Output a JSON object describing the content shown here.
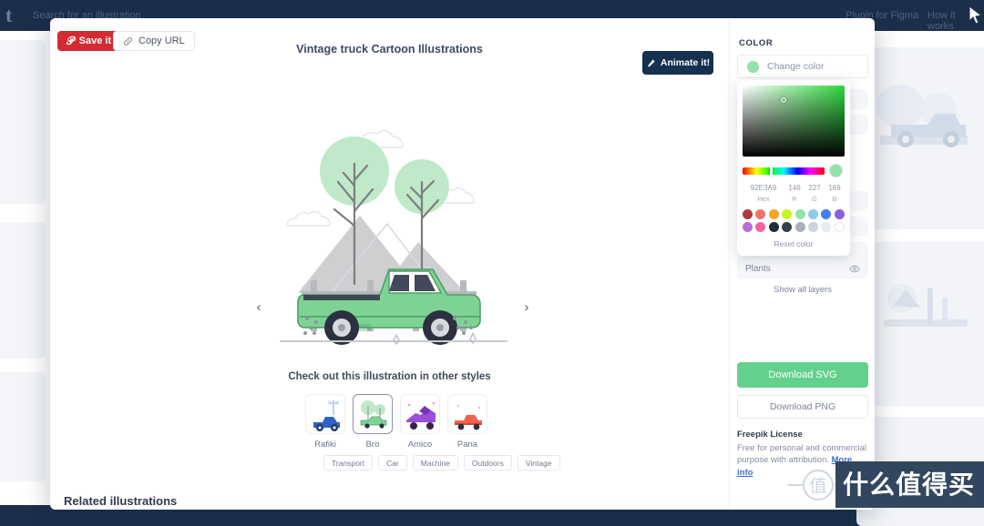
{
  "background": {
    "logo": "t",
    "search_placeholder": "Search for an illustration",
    "nav": [
      {
        "label": "Plugin for Figma"
      },
      {
        "label": "How it works"
      }
    ]
  },
  "modal": {
    "save_label": "Save it",
    "copy_label": "Copy URL",
    "title": "Vintage truck Cartoon Illustrations",
    "animate_label": "Animate it!",
    "prev_arrow": "‹",
    "next_arrow": "›",
    "styles_heading": "Check out this illustration in other styles",
    "styles": [
      {
        "label": "Rafiki",
        "selected": false
      },
      {
        "label": "Bro",
        "selected": true
      },
      {
        "label": "Amico",
        "selected": false
      },
      {
        "label": "Pana",
        "selected": false
      }
    ],
    "tags": [
      "Transport",
      "Car",
      "Machine",
      "Outdoors",
      "Vintage"
    ]
  },
  "panel": {
    "section_label": "COLOR",
    "change_color_label": "Change color",
    "current_color": "#92E3A9",
    "layers": [
      {
        "name": "Plants",
        "eye": "👁"
      }
    ],
    "show_all_layers": "Show all layers",
    "download_svg": "Download SVG",
    "download_png": "Download PNG",
    "license_title": "Freepik License",
    "license_text": "Free for personal and commercial purpose with attribution. ",
    "license_link": "More info"
  },
  "picker": {
    "hex": "92E3A9",
    "r": "146",
    "g": "227",
    "b": "169",
    "label_hex": "Hex",
    "label_r": "R",
    "label_g": "G",
    "label_b": "B",
    "reset_label": "Reset color",
    "swatches": [
      "#b03a3a",
      "#f1736b",
      "#f5a623",
      "#c8f521",
      "#92e3a9",
      "#8fc9f2",
      "#4a7df0",
      "#8b5fe0",
      "#b86cd8",
      "#f2639e",
      "#202b3c",
      "#34404f",
      "#a8b1bd",
      "#ccd3dc",
      "#e9edf2",
      "#ffffff"
    ]
  },
  "page": {
    "related_heading": "Related illustrations"
  },
  "watermark": {
    "mark": "值",
    "text": "什么值得买"
  }
}
